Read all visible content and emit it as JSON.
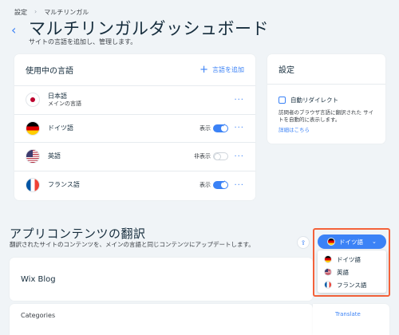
{
  "breadcrumb": {
    "root": "設定",
    "separator": "›",
    "current": "マルチリンガル"
  },
  "header": {
    "back_icon": "chevron-left-icon",
    "title": "マルチリンガルダッシュボード",
    "subtitle": "サイトの言語を追加し、管理します。"
  },
  "languages_card": {
    "title": "使用中の言語",
    "add_label": "言語を追加",
    "add_icon": "plus-icon",
    "more_label": "···",
    "rows": [
      {
        "name": "日本語",
        "sub": "メインの言語",
        "flag": "japan-flag-icon"
      },
      {
        "name": "ドイツ語",
        "flag": "germany-flag-icon",
        "status": "表示",
        "toggle": "on"
      },
      {
        "name": "英語",
        "flag": "us-flag-icon",
        "status": "非表示",
        "toggle": "off"
      },
      {
        "name": "フランス語",
        "flag": "france-flag-icon",
        "status": "表示",
        "toggle": "on"
      }
    ]
  },
  "settings_card": {
    "title": "設定",
    "checkbox_label": "自動リダイレクト",
    "description": "訪問者のブラウザ言語に翻訳された サイトを自動的に表示します。",
    "link": "詳細はこちら"
  },
  "content_section": {
    "title": "アプリコンテンツの翻訳",
    "subtitle": "翻訳されたサイトのコンテンツを、メインの言語と同じコンテンツにアップデートします。",
    "upload_icon": "upload-icon",
    "blog_title": "Wix Blog",
    "category_label": "Categories",
    "translate_link": "Translate"
  },
  "language_dropdown": {
    "selected": "ドイツ語",
    "options": [
      "ドイツ語",
      "英語",
      "フランス語"
    ],
    "highlight_color": "#f4623a",
    "accent_color": "#3b82f6"
  }
}
